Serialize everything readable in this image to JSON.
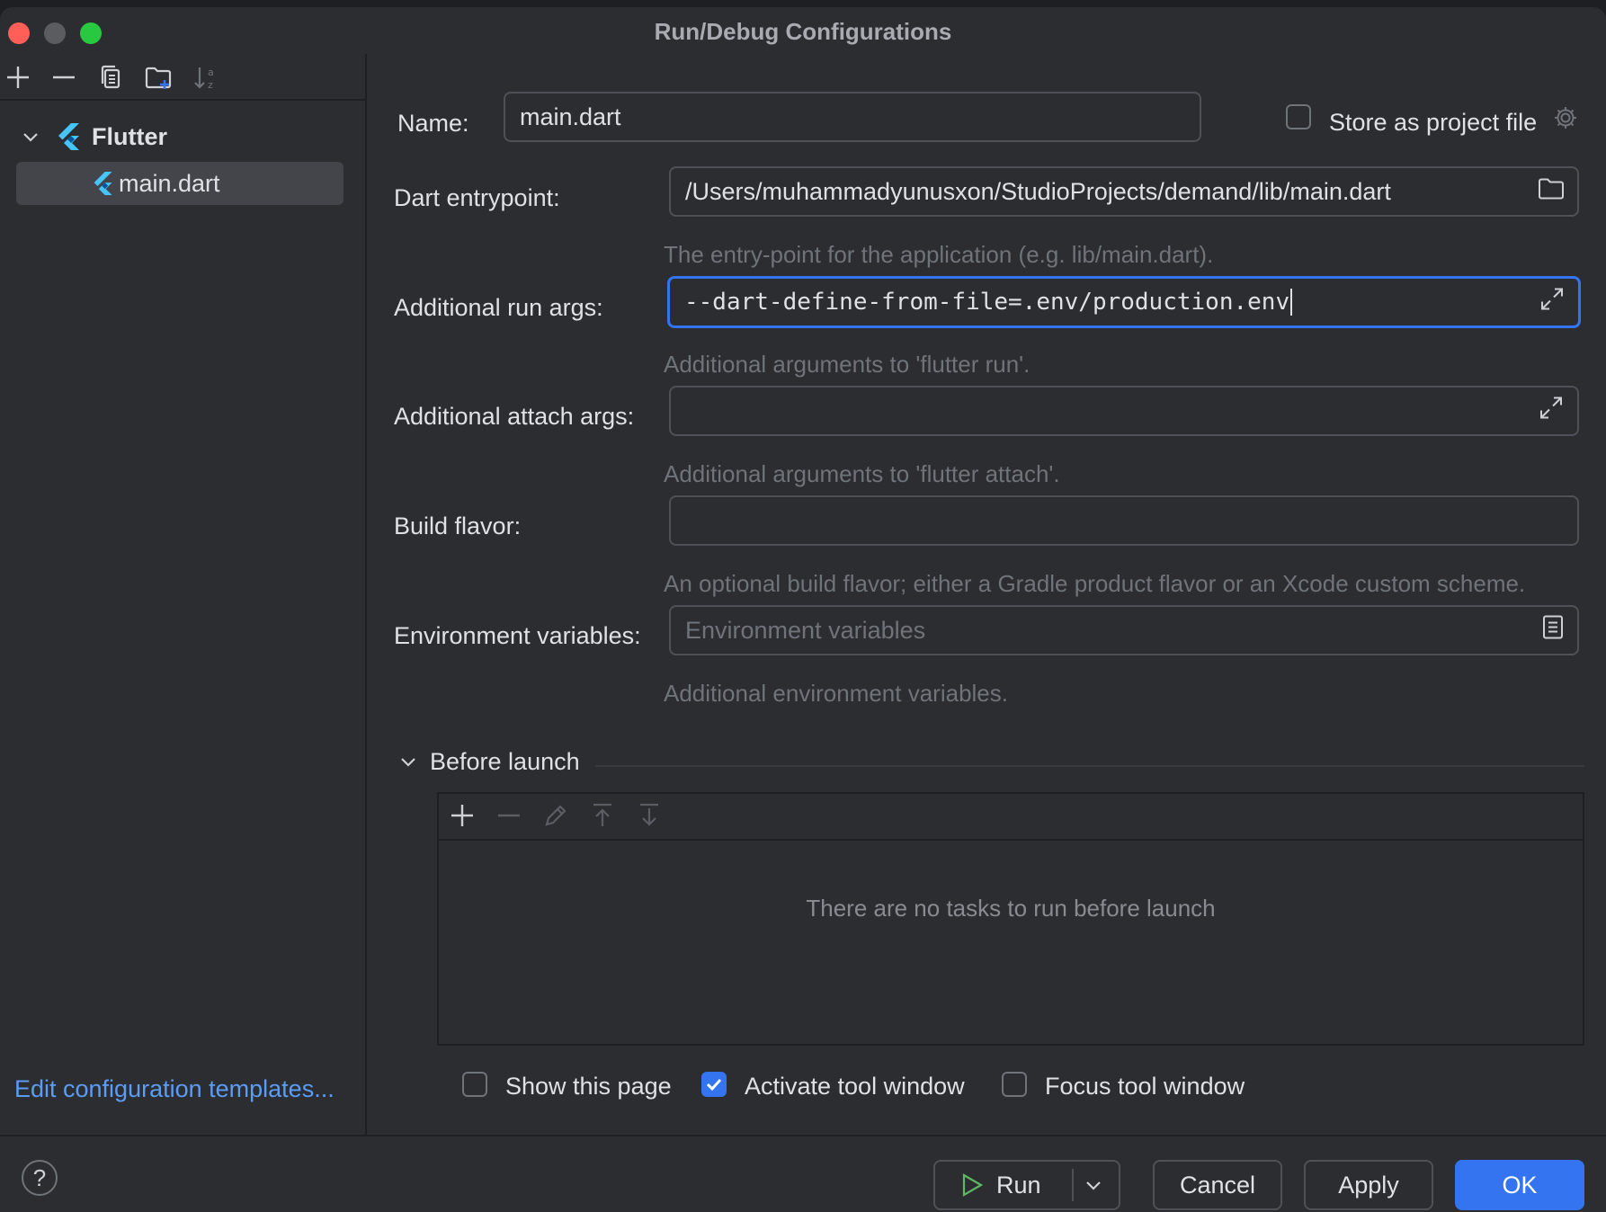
{
  "window": {
    "title": "Run/Debug Configurations"
  },
  "colors": {
    "accent": "#3574f0",
    "close": "#ff5f57",
    "minimize": "#5a5c60",
    "maximize": "#28c840",
    "link": "#5c9cf5",
    "flutter": "#47c5fb"
  },
  "sidebar": {
    "toolbar_icons": [
      "add-icon",
      "remove-icon",
      "copy-icon",
      "new-folder-icon",
      "sort-icon"
    ],
    "tree": {
      "group_label": "Flutter",
      "item_label": "main.dart"
    },
    "templates_link": "Edit configuration templates..."
  },
  "form": {
    "name_label": "Name:",
    "name_value": "main.dart",
    "store_label": "Store as project file",
    "entry_label": "Dart entrypoint:",
    "entry_value": "/Users/muhammadyunusxon/StudioProjects/demand/lib/main.dart",
    "entry_hint": "The entry-point for the application (e.g. lib/main.dart).",
    "run_args_label": "Additional run args:",
    "run_args_value": "--dart-define-from-file=.env/production.env",
    "run_args_hint": "Additional arguments to 'flutter run'.",
    "attach_args_label": "Additional attach args:",
    "attach_args_value": "",
    "attach_args_hint": "Additional arguments to 'flutter attach'.",
    "flavor_label": "Build flavor:",
    "flavor_value": "",
    "flavor_hint": "An optional build flavor; either a Gradle product flavor or an Xcode custom scheme.",
    "env_label": "Environment variables:",
    "env_placeholder": "Environment variables",
    "env_hint": "Additional environment variables."
  },
  "before_launch": {
    "title": "Before launch",
    "empty_text": "There are no tasks to run before launch",
    "toolbar_icons": [
      "add-icon",
      "remove-icon",
      "edit-icon",
      "move-up-icon",
      "move-down-icon"
    ]
  },
  "options": {
    "show_page_label": "Show this page",
    "show_page_checked": false,
    "activate_label": "Activate tool window",
    "activate_checked": true,
    "focus_label": "Focus tool window",
    "focus_checked": false
  },
  "footer": {
    "run_label": "Run",
    "cancel_label": "Cancel",
    "apply_label": "Apply",
    "ok_label": "OK"
  }
}
